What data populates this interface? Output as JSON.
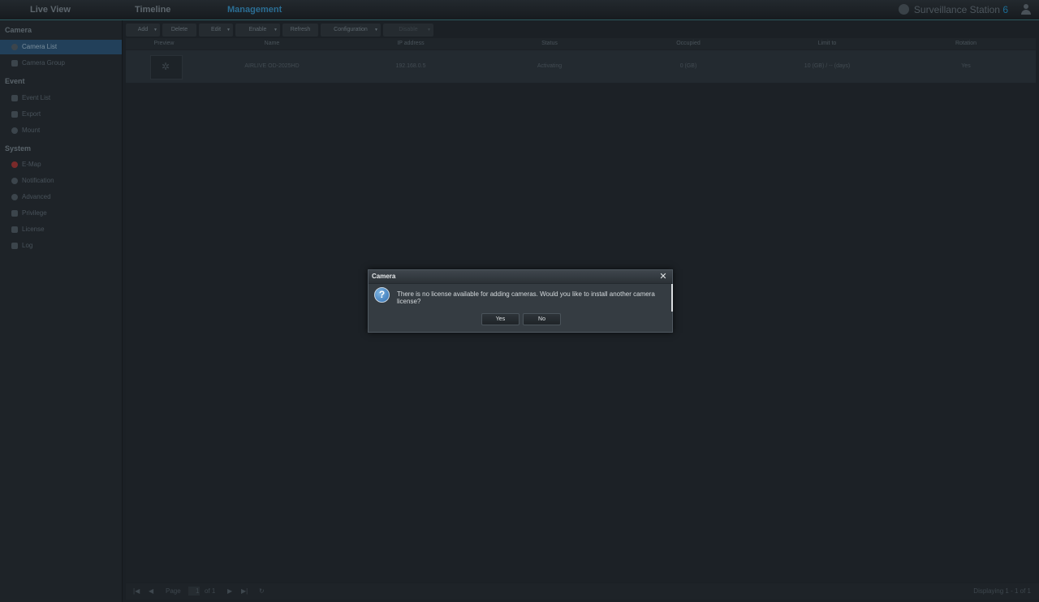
{
  "topbar": {
    "tabs": [
      "Live View",
      "Timeline",
      "Management"
    ],
    "brand": "Surveillance Station",
    "brand_version": "6"
  },
  "sidebar": {
    "sections": {
      "camera": {
        "title": "Camera",
        "items": [
          "Camera List",
          "Camera Group"
        ]
      },
      "event": {
        "title": "Event",
        "items": [
          "Event List",
          "Export",
          "Mount"
        ]
      },
      "system": {
        "title": "System",
        "items": [
          "E-Map",
          "Notification",
          "Advanced",
          "Privilege",
          "License",
          "Log"
        ]
      }
    }
  },
  "toolbar": {
    "buttons": [
      "Add",
      "Delete",
      "Edit",
      "Enable",
      "Refresh",
      "Configuration",
      "Disable"
    ]
  },
  "grid": {
    "columns": [
      "Preview",
      "Name",
      "IP address",
      "Status",
      "Occupied",
      "Limit to",
      "Rotation"
    ],
    "rows": [
      {
        "name": "AIRLIVE OD-2025HD",
        "ip": "192.168.0.5",
        "status": "Activating",
        "occupied": "0 (GB)",
        "limit": "10 (GB) / -- (days)",
        "rotation": "Yes"
      }
    ]
  },
  "footer": {
    "page_label": "Page",
    "page_value": "1",
    "of_label": "of 1",
    "displaying": "Displaying 1 - 1 of 1"
  },
  "dialog": {
    "title": "Camera",
    "message": "There is no license available for adding cameras. Would you like to install another camera license?",
    "yes_label": "Yes",
    "no_label": "No"
  },
  "colors": {
    "accent": "#1c6d96",
    "active_tab": "#2b6d93",
    "selected_row": "#22405a"
  }
}
